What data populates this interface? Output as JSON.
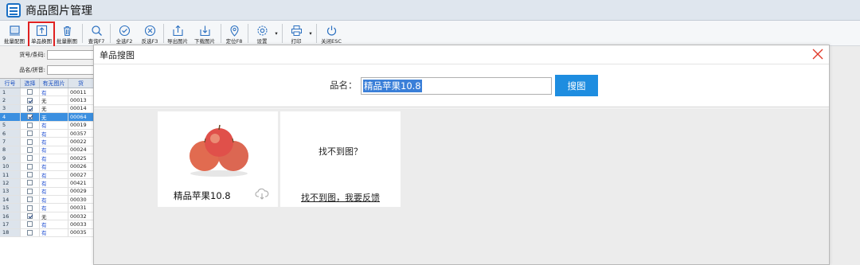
{
  "app": {
    "title": "商品图片管理"
  },
  "toolbar": {
    "items": [
      {
        "label": "批量配图",
        "icon": "stack-icon"
      },
      {
        "label": "单品换图",
        "icon": "upload-icon"
      },
      {
        "label": "批量删图",
        "icon": "trash-icon"
      },
      {
        "label": "查询F7",
        "icon": "search-icon"
      },
      {
        "label": "全选F2",
        "icon": "check-circle-icon"
      },
      {
        "label": "反选F3",
        "icon": "x-circle-icon"
      },
      {
        "label": "导出图片",
        "icon": "export-icon"
      },
      {
        "label": "下载图片",
        "icon": "download-icon"
      },
      {
        "label": "定位F8",
        "icon": "location-pin-icon"
      },
      {
        "label": "设置",
        "icon": "gear-icon"
      },
      {
        "label": "打印",
        "icon": "printer-icon"
      },
      {
        "label": "关闭ESC",
        "icon": "power-icon"
      }
    ]
  },
  "filter": {
    "code_label": "货号/条码:",
    "name_label": "品名/拼音:"
  },
  "grid": {
    "headers": [
      "行号",
      "选择",
      "有无图片",
      "货"
    ],
    "rows": [
      {
        "no": "1",
        "checked": false,
        "has": "有",
        "code": "00011"
      },
      {
        "no": "2",
        "checked": true,
        "has": "无",
        "code": "00013"
      },
      {
        "no": "3",
        "checked": true,
        "has": "无",
        "code": "00014"
      },
      {
        "no": "4",
        "checked": true,
        "has": "无",
        "code": "00064",
        "selected": true
      },
      {
        "no": "5",
        "checked": false,
        "has": "有",
        "code": "00019"
      },
      {
        "no": "6",
        "checked": false,
        "has": "有",
        "code": "00357"
      },
      {
        "no": "7",
        "checked": false,
        "has": "有",
        "code": "00022"
      },
      {
        "no": "8",
        "checked": false,
        "has": "有",
        "code": "00024"
      },
      {
        "no": "9",
        "checked": false,
        "has": "有",
        "code": "00025"
      },
      {
        "no": "10",
        "checked": false,
        "has": "有",
        "code": "00026"
      },
      {
        "no": "11",
        "checked": false,
        "has": "有",
        "code": "00027"
      },
      {
        "no": "12",
        "checked": false,
        "has": "有",
        "code": "00421"
      },
      {
        "no": "13",
        "checked": false,
        "has": "有",
        "code": "00029"
      },
      {
        "no": "14",
        "checked": false,
        "has": "有",
        "code": "00030"
      },
      {
        "no": "15",
        "checked": false,
        "has": "有",
        "code": "00031"
      },
      {
        "no": "16",
        "checked": true,
        "has": "无",
        "code": "00032"
      },
      {
        "no": "17",
        "checked": false,
        "has": "有",
        "code": "00033"
      },
      {
        "no": "18",
        "checked": false,
        "has": "有",
        "code": "00035"
      }
    ]
  },
  "dialog": {
    "title": "单品搜图",
    "search_label": "品名：",
    "search_value": "精品苹果10.8",
    "search_button": "搜图",
    "result_name": "精品苹果10.8",
    "not_found_title": "找不到图？",
    "not_found_link": "找不到图，我要反馈"
  },
  "colors": {
    "accent": "#1e8de0",
    "highlight": "#e02020",
    "selected_row": "#3b8fe0"
  }
}
